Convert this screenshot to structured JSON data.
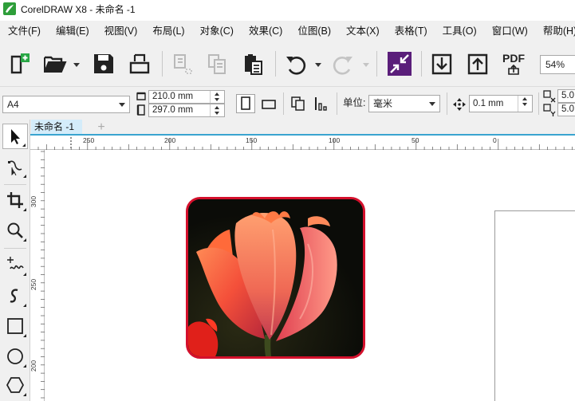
{
  "window": {
    "title": "CorelDRAW X8 - 未命名 -1"
  },
  "menu": [
    "文件(F)",
    "编辑(E)",
    "视图(V)",
    "布局(L)",
    "对象(C)",
    "效果(C)",
    "位图(B)",
    "文本(X)",
    "表格(T)",
    "工具(O)",
    "窗口(W)",
    "帮助(H)"
  ],
  "toolbar": {
    "pdf_label": "PDF",
    "zoom": "54%"
  },
  "property_bar": {
    "page_size": "A4",
    "width": "210.0 mm",
    "height": "297.0 mm",
    "units_label": "单位:",
    "units_value": "毫米",
    "nudge": "0.1 mm",
    "dup_x": "5.0",
    "dup_y": "5.0"
  },
  "document": {
    "tab": "未命名 -1"
  },
  "ruler": {
    "h_ticks": [
      "250",
      "200",
      "150",
      "100",
      "50",
      "0"
    ],
    "v_ticks": [
      "300",
      "250",
      "200"
    ]
  },
  "colors": {
    "accent": "#3aa4d0",
    "frame_red": "#d4102c",
    "panel_bg": "#f0f0f0"
  }
}
